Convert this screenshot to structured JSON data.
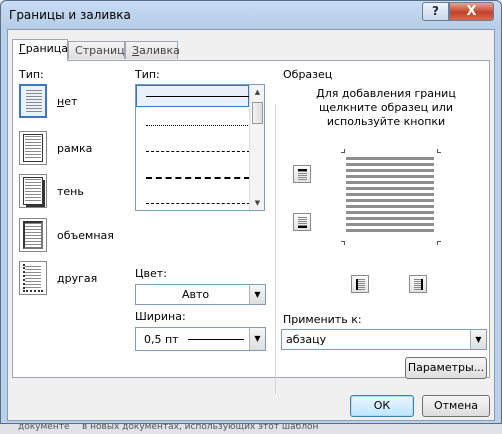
{
  "window": {
    "title": "Границы и заливка",
    "help_label": "?",
    "close_label": "X"
  },
  "tabs": [
    {
      "label": "Граница",
      "mnemonic": "Г",
      "rest": "раница",
      "active": true
    },
    {
      "label": "Страница",
      "mnemonic": "С",
      "rest": "траница",
      "active": false
    },
    {
      "label": "Заливка",
      "mnemonic": "З",
      "rest": "аливка",
      "active": false
    }
  ],
  "setting": {
    "heading": "Тип:",
    "items": [
      {
        "label": "нет",
        "mnemonic": "н",
        "rest": "ет",
        "icon": "border-none-icon",
        "selected": true
      },
      {
        "label": "рамка",
        "mnemonic": "",
        "rest": "рамка",
        "icon": "border-box-icon",
        "selected": false
      },
      {
        "label": "тень",
        "mnemonic": "",
        "rest": "тень",
        "icon": "border-shadow-icon",
        "selected": false
      },
      {
        "label": "объемная",
        "mnemonic": "",
        "rest": "объемная",
        "icon": "border-3d-icon",
        "selected": false
      },
      {
        "label": "другая",
        "mnemonic": "",
        "rest": "другая",
        "icon": "border-custom-icon",
        "selected": false
      }
    ]
  },
  "style": {
    "heading": "Тип:",
    "lines": [
      "solid",
      "dotted",
      "dashed-small",
      "dashed",
      "dash-dot"
    ]
  },
  "color": {
    "label": "Цвет:",
    "value": "Авто"
  },
  "width": {
    "label": "Ширина:",
    "value": "0,5 пт"
  },
  "preview": {
    "heading": "Образец",
    "instruction_line1": "Для добавления границ",
    "instruction_line2": "щелкните образец или",
    "instruction_line3": "используйте кнопки"
  },
  "apply_to": {
    "label": "Применить к:",
    "value": "абзацу"
  },
  "buttons": {
    "options": "Параметры...",
    "ok": "ОК",
    "cancel": "Отмена"
  },
  "background_strip": {
    "left_text": "документе",
    "right_text": "в новых документах, использующих этот шаблон"
  },
  "colors": {
    "frame": "#b9d1ea",
    "close_button": "#c4402a",
    "selection_border": "#3c78c2"
  }
}
